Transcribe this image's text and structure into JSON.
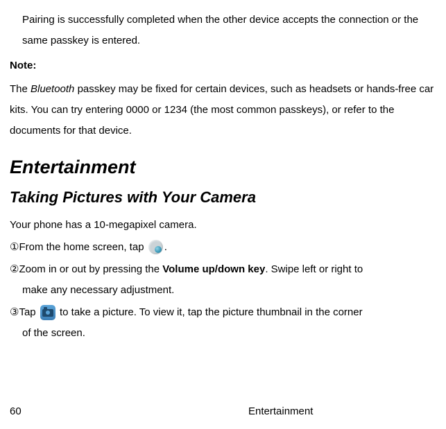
{
  "pairing_complete": "Pairing is successfully completed when the other device accepts the connection or the same passkey is entered.",
  "note_label": "Note",
  "note_colon": ":",
  "note_prefix": "The ",
  "note_bluetooth": "Bluetooth",
  "note_rest": " passkey may be fixed for certain devices, such as headsets or hands-free car kits. You can try entering 0000 or 1234 (the most common passkeys), or refer to the documents for that device.",
  "section_title": "Entertainment",
  "subsection_title": "Taking Pictures with Your Camera",
  "camera_intro": "Your phone has a 10-megapixel camera.",
  "step1_num": "①",
  "step1_text": "From the home screen, tap ",
  "step1_period": ".",
  "step2_num": "②",
  "step2_a": "Zoom in or out by pressing the ",
  "step2_bold": "Volume up/down key",
  "step2_b": ". Swipe left or right to",
  "step2_line2": "make any necessary adjustment.",
  "step3_num": "③",
  "step3_a": "Tap ",
  "step3_b": " to take a picture. To view it, tap the picture thumbnail in the corner",
  "step3_line2": "of the screen.",
  "page_number": "60",
  "footer_section": "Entertainment"
}
